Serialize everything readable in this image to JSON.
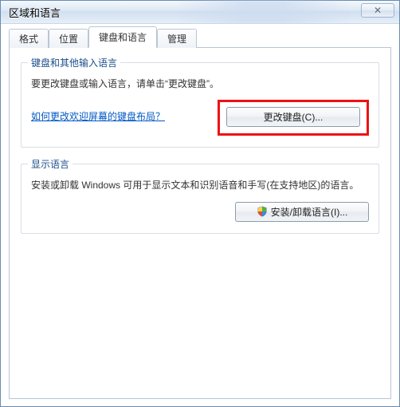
{
  "window": {
    "title": "区域和语言",
    "close_glyph": "✕"
  },
  "tabs": [
    {
      "label": "格式"
    },
    {
      "label": "位置"
    },
    {
      "label": "键盘和语言"
    },
    {
      "label": "管理"
    }
  ],
  "group_keyboard": {
    "legend": "键盘和其他输入语言",
    "desc": "要更改键盘或输入语言，请单击“更改键盘”。",
    "button": "更改键盘(C)...",
    "link": "如何更改欢迎屏幕的键盘布局？"
  },
  "group_display": {
    "legend": "显示语言",
    "desc": "安装或卸载 Windows 可用于显示文本和识别语音和手写(在支持地区)的语言。",
    "button": "安装/卸载语言(I)..."
  }
}
